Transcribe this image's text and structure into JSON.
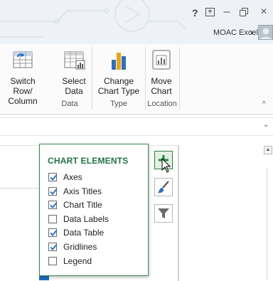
{
  "titlebar": {
    "help_label": "?",
    "user_name": "MOAC Excel",
    "user_caret": "▾",
    "controls": {
      "minimize": "–",
      "close": "×"
    }
  },
  "ribbon": {
    "buttons": [
      {
        "line1": "Switch Row/",
        "line2": "Column",
        "icon": "switch-row-column-icon"
      },
      {
        "line1": "Select",
        "line2": "Data",
        "icon": "select-data-icon"
      },
      {
        "line1": "Change",
        "line2": "Chart Type",
        "icon": "change-chart-type-icon"
      },
      {
        "line1": "Move",
        "line2": "Chart",
        "icon": "move-chart-icon"
      }
    ],
    "groups": [
      "Data",
      "Type",
      "Location"
    ],
    "collapse_glyph": "^"
  },
  "formula_bar": {
    "expand_glyph": "⌄"
  },
  "chart_elements": {
    "title": "CHART ELEMENTS",
    "items": [
      {
        "label": "Axes",
        "checked": true
      },
      {
        "label": "Axis Titles",
        "checked": true
      },
      {
        "label": "Chart Title",
        "checked": true
      },
      {
        "label": "Data Labels",
        "checked": false
      },
      {
        "label": "Data Table",
        "checked": true
      },
      {
        "label": "Gridlines",
        "checked": true
      },
      {
        "label": "Legend",
        "checked": false
      }
    ]
  },
  "side_buttons": [
    {
      "name": "chart-elements",
      "icon": "plus-icon",
      "active": true
    },
    {
      "name": "chart-styles",
      "icon": "paintbrush-icon",
      "active": false
    },
    {
      "name": "chart-filters",
      "icon": "filter-icon",
      "active": false
    }
  ],
  "colors": {
    "accent_green": "#217346",
    "checkbox_blue": "#1f6ebd"
  }
}
